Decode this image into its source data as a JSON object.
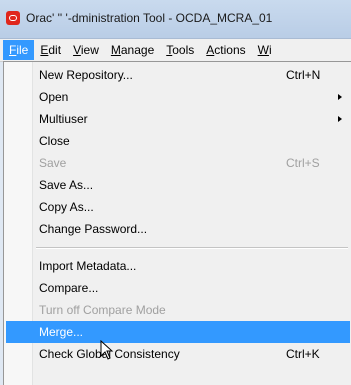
{
  "window": {
    "title": "Orac' '' '-dministration Tool - OCDA_MCRA_01"
  },
  "menubar": {
    "items": [
      {
        "label": "File",
        "mnemonic": "F",
        "rest": "ile"
      },
      {
        "label": "Edit",
        "mnemonic": "E",
        "rest": "dit"
      },
      {
        "label": "View",
        "mnemonic": "V",
        "rest": "iew"
      },
      {
        "label": "Manage",
        "mnemonic": "M",
        "rest": "anage"
      },
      {
        "label": "Tools",
        "mnemonic": "T",
        "rest": "ools"
      },
      {
        "label": "Actions",
        "mnemonic": "A",
        "rest": "ctions"
      },
      {
        "label": "Wi",
        "mnemonic": "W",
        "rest": "i"
      }
    ]
  },
  "file_menu": {
    "items": [
      {
        "label": "New Repository...",
        "shortcut": "Ctrl+N"
      },
      {
        "label": "Open",
        "submenu": true
      },
      {
        "label": "Multiuser",
        "submenu": true
      },
      {
        "label": "Close"
      },
      {
        "label": "Save",
        "shortcut": "Ctrl+S",
        "disabled": true
      },
      {
        "label": "Save As..."
      },
      {
        "label": "Copy As..."
      },
      {
        "label": "Change Password..."
      },
      {
        "label": "Import Metadata..."
      },
      {
        "label": "Compare..."
      },
      {
        "label": "Turn off Compare Mode",
        "disabled": true
      },
      {
        "label": "Merge...",
        "highlighted": true
      },
      {
        "label": "Check Global Consistency",
        "shortcut": "Ctrl+K"
      }
    ]
  },
  "colors": {
    "highlight": "#3399ff",
    "oracle_red": "#e0261c",
    "disabled_text": "#a0a0a0"
  }
}
